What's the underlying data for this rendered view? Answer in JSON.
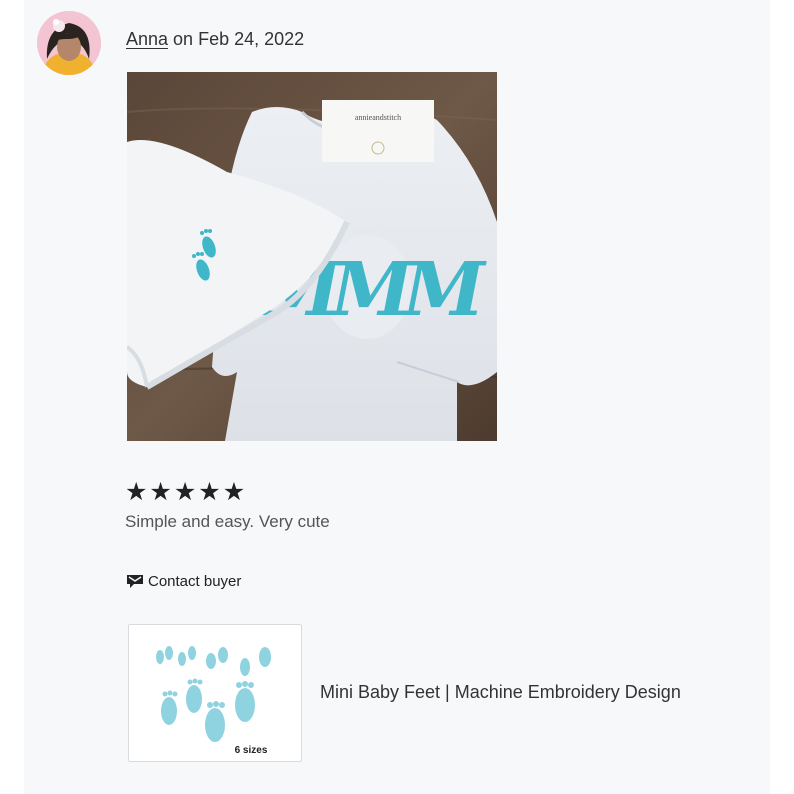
{
  "review": {
    "author": "Anna",
    "date_prefix": " on ",
    "date": "Feb 24, 2022",
    "rating": 5,
    "rating_max": 5,
    "text": "Simple and easy. Very cute"
  },
  "photo": {
    "tag_brand": "annieandstitch",
    "monogram": "MMM"
  },
  "contact": {
    "label": "Contact buyer",
    "icon": "message-flag-icon"
  },
  "product": {
    "title": "Mini Baby Feet | Machine Embroidery Design",
    "thumb_caption": "6 sizes"
  },
  "colors": {
    "panel_bg": "#f7f8fa",
    "embroidery_blue": "#3fb7c9",
    "thumb_feet": "#8fd3e0",
    "text_dark": "#222222"
  }
}
